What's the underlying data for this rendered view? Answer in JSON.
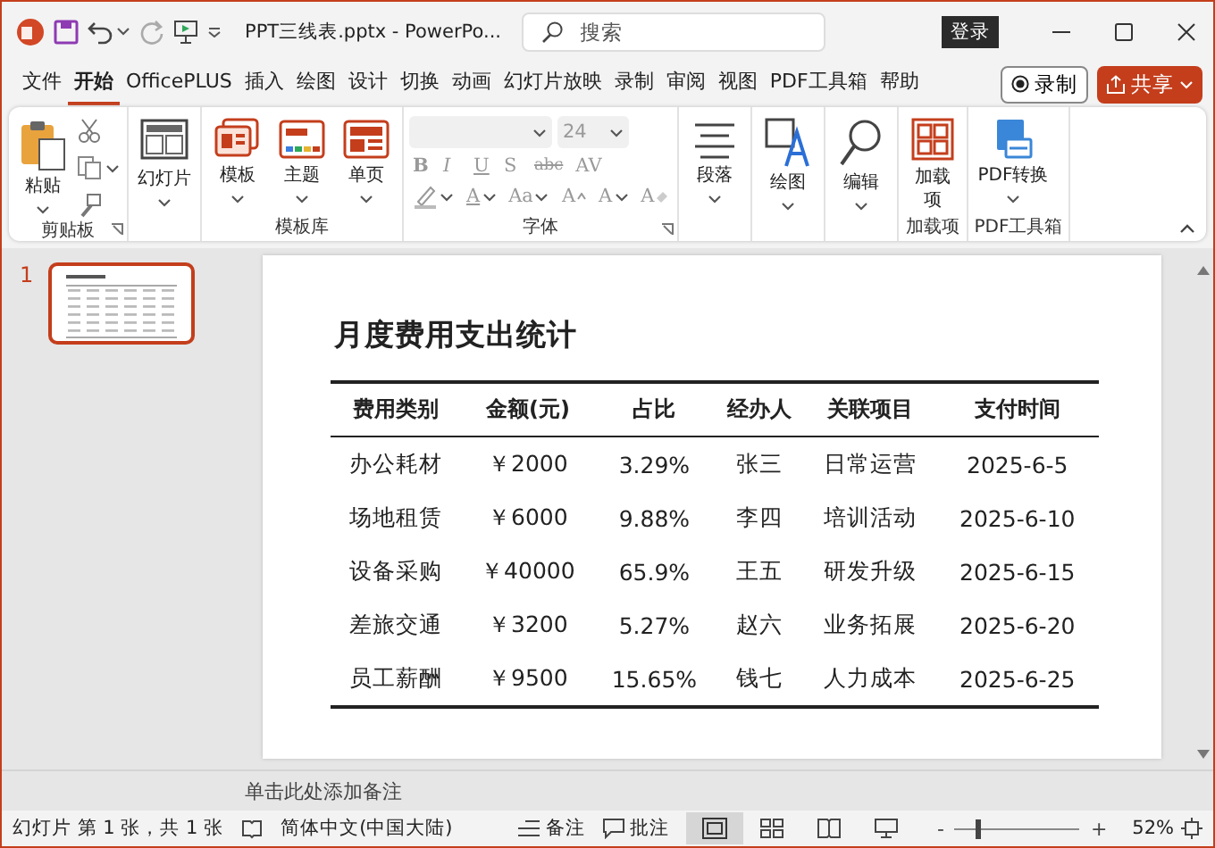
{
  "title_bar": {
    "title": "PPT三线表.pptx  -  PowerPo...",
    "search": {
      "placeholder": "搜索"
    },
    "login_button": "登录"
  },
  "tabs": [
    {
      "label": "文件",
      "selected": false
    },
    {
      "label": "开始",
      "selected": true
    },
    {
      "label": "OfficePLUS",
      "selected": false
    },
    {
      "label": "插入",
      "selected": false
    },
    {
      "label": "绘图",
      "selected": false
    },
    {
      "label": "设计",
      "selected": false
    },
    {
      "label": "切换",
      "selected": false
    },
    {
      "label": "动画",
      "selected": false
    },
    {
      "label": "幻灯片放映",
      "selected": false
    },
    {
      "label": "录制",
      "selected": false
    },
    {
      "label": "审阅",
      "selected": false
    },
    {
      "label": "视图",
      "selected": false
    },
    {
      "label": "PDF工具箱",
      "selected": false
    },
    {
      "label": "帮助",
      "selected": false
    }
  ],
  "record_button": "录制",
  "share_button": "共享",
  "ribbon": {
    "groups": [
      {
        "kind": "clipboard",
        "label": "剪贴板",
        "launcher": true,
        "items": [
          {
            "kind": "paste",
            "label": "粘贴"
          }
        ]
      },
      {
        "kind": "buttons",
        "items": [
          {
            "kind": "layout",
            "label": "幻灯片"
          }
        ]
      },
      {
        "kind": "buttons",
        "label": "模板库",
        "items": [
          {
            "kind": "template",
            "label": "模板"
          },
          {
            "kind": "theme",
            "label": "主题"
          },
          {
            "kind": "page",
            "label": "单页"
          }
        ]
      },
      {
        "kind": "font",
        "label": "字体",
        "launcher": true,
        "font_size": "24",
        "format_buttons": [
          "B",
          "I",
          "U",
          "S",
          "abc",
          "AV"
        ],
        "color_buttons": [
          {
            "kind": "highlight"
          },
          {
            "kind": "color",
            "label": "A"
          },
          {
            "kind": "case",
            "label": "Aa"
          },
          {
            "kind": "grow",
            "label": "A"
          },
          {
            "kind": "shrink",
            "label": "A"
          },
          {
            "kind": "clear",
            "label": "A"
          }
        ]
      },
      {
        "kind": "buttons",
        "items": [
          {
            "kind": "paragraph",
            "label": "段落"
          }
        ]
      },
      {
        "kind": "buttons",
        "items": [
          {
            "kind": "draw",
            "label": "绘图"
          }
        ]
      },
      {
        "kind": "buttons",
        "items": [
          {
            "kind": "edit",
            "label": "编辑"
          }
        ]
      },
      {
        "kind": "buttons",
        "label": "加载项",
        "items": [
          {
            "kind": "addins",
            "label": "加载项"
          }
        ]
      },
      {
        "kind": "buttons",
        "label": "PDF工具箱",
        "items": [
          {
            "kind": "pdf",
            "label": "PDF转换"
          }
        ]
      }
    ]
  },
  "thumbnails": [
    {
      "number": "1",
      "selected": true
    }
  ],
  "slide": {
    "title": "月度费用支出统计",
    "table": {
      "columns": [
        "费用类别",
        "金额(元)",
        "占比",
        "经办人",
        "关联项目",
        "支付时间"
      ],
      "rows": [
        [
          "办公耗材",
          "￥2000",
          "3.29%",
          "张三",
          "日常运营",
          "2025-6-5"
        ],
        [
          "场地租赁",
          "￥6000",
          "9.88%",
          "李四",
          "培训活动",
          "2025-6-10"
        ],
        [
          "设备采购",
          "￥40000",
          "65.9%",
          "王五",
          "研发升级",
          "2025-6-15"
        ],
        [
          "差旅交通",
          "￥3200",
          "5.27%",
          "赵六",
          "业务拓展",
          "2025-6-20"
        ],
        [
          "员工薪酬",
          "￥9500",
          "15.65%",
          "钱七",
          "人力成本",
          "2025-6-25"
        ]
      ]
    }
  },
  "notes": {
    "placeholder": "单击此处添加备注"
  },
  "status_bar": {
    "slide_info": "幻灯片 第 1 张，共 1 张",
    "language": "简体中文(中国大陆)",
    "notes_button": "备注",
    "comments_button": "批注",
    "views": [
      {
        "kind": "normal",
        "selected": true
      },
      {
        "kind": "sorter",
        "selected": false
      },
      {
        "kind": "reading",
        "selected": false
      },
      {
        "kind": "show",
        "selected": false
      }
    ],
    "zoom_out": "-",
    "zoom_in": "+",
    "zoom": {
      "level": 0.17
    },
    "zoom_value": "52%"
  }
}
